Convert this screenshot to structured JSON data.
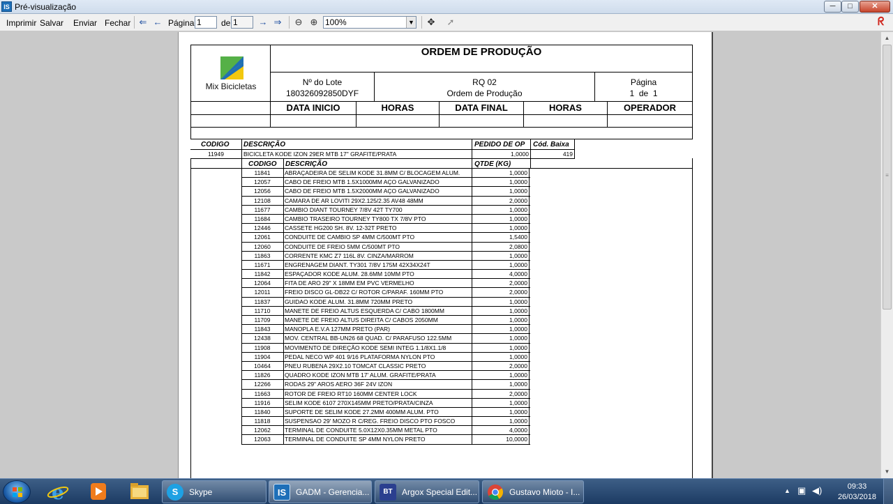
{
  "window": {
    "title": "Pré-visualização",
    "controls": {
      "minimize": "─",
      "maximize": "□",
      "close": "✕"
    }
  },
  "toolbar": {
    "print_label": "Imprimir",
    "save_label": "Salvar",
    "send_label": "Enviar",
    "close_label": "Fechar",
    "page_label": "Página",
    "page_value": "1",
    "of_label": "de",
    "total_pages": "1",
    "zoom_value": "100%"
  },
  "report": {
    "title": "ORDEM DE PRODUÇÃO",
    "logo_text": "Mix Bicicletas",
    "lot_label": "Nº do Lote",
    "lot_value": "180326092850DYF",
    "rq_code": "RQ 02",
    "rq_desc": "Ordem de Produção",
    "page_label": "Página",
    "page_value": "1  de  1",
    "columns": [
      "DATA INICIO",
      "HORAS",
      "DATA FINAL",
      "HORAS",
      "OPERADOR"
    ],
    "product_header": {
      "code": "CODIGO",
      "desc": "DESCRIÇÃO",
      "qty": "PEDIDO DE OP",
      "lower_code": "Cód. Baixa"
    },
    "product": {
      "code": "11949",
      "desc": "BICICLETA KODE IZON 29ER MTB 17\" GRAFITE/PRATA",
      "qty": "1,0000",
      "lower_code": "419"
    },
    "materials_header": {
      "code": "CODIGO",
      "desc": "DESCRIÇÃO",
      "qty": "QTDE (KG)"
    },
    "materials": [
      {
        "code": "11841",
        "desc": "ABRAÇADEIRA DE SELIM KODE 31.8MM C/ BLOCAGEM ALUM.",
        "qty": "1,0000"
      },
      {
        "code": "12057",
        "desc": "CABO DE FREIO MTB 1.5X1000MM AÇO GALVANIZADO",
        "qty": "1,0000"
      },
      {
        "code": "12056",
        "desc": "CABO DE FREIO MTB 1.5X2000MM AÇO GALVANIZADO",
        "qty": "1,0000"
      },
      {
        "code": "12108",
        "desc": "CAMARA DE AR LOVITI 29X2.125/2.35 AV48 48MM",
        "qty": "2,0000"
      },
      {
        "code": "11677",
        "desc": "CAMBIO DIANT TOURNEY  7/8V 42T TY700",
        "qty": "1,0000"
      },
      {
        "code": "11684",
        "desc": "CAMBIO TRASEIRO TOURNEY TY800 TX 7/8V PTO",
        "qty": "1,0000"
      },
      {
        "code": "12446",
        "desc": "CASSETE HG200 SH. 8V. 12-32T PRETO",
        "qty": "1,0000"
      },
      {
        "code": "12061",
        "desc": "CONDUITE DE CAMBIO SP 4MM C/500MT PTO",
        "qty": "1,5400"
      },
      {
        "code": "12060",
        "desc": "CONDUITE DE FREIO 5MM C/500MT PTO",
        "qty": "2,0800"
      },
      {
        "code": "11863",
        "desc": "CORRENTE KMC Z7 116L 8V. CINZA/MARROM",
        "qty": "1,0000"
      },
      {
        "code": "11671",
        "desc": "ENGRENAGEM DIANT.  TY301 7/8V 175M 42X34X24T",
        "qty": "1,0000"
      },
      {
        "code": "11842",
        "desc": "ESPAÇADOR KODE ALUM. 28.6MM 10MM PTO",
        "qty": "4,0000"
      },
      {
        "code": "12064",
        "desc": "FITA DE ARO 29\" X 18MM EM PVC VERMELHO",
        "qty": "2,0000"
      },
      {
        "code": "12011",
        "desc": "FREIO DISCO GL-DB22 C/ ROTOR C/PARAF. 160MM PTO",
        "qty": "2,0000"
      },
      {
        "code": "11837",
        "desc": "GUIDAO KODE ALUM. 31.8MM 720MM PRETO",
        "qty": "1,0000"
      },
      {
        "code": "11710",
        "desc": "MANETE DE  FREIO ALTUS ESQUERDA C/ CABO 1800MM",
        "qty": "1,0000"
      },
      {
        "code": "11709",
        "desc": "MANETE DE FREIO ALTUS DIREITA C/ CABOS 2050MM",
        "qty": "1,0000"
      },
      {
        "code": "11843",
        "desc": "MANOPLA E.V.A 127MM PRETO (PAR)",
        "qty": "1,0000"
      },
      {
        "code": "12438",
        "desc": "MOV. CENTRAL BB-UN26 68 QUAD. C/ PARAFUSO 122.5MM",
        "qty": "1,0000"
      },
      {
        "code": "11908",
        "desc": "MOVIMENTO DE DIREÇÃO KODE SEMI INTEG 1.1/8X1.1/8",
        "qty": "1,0000"
      },
      {
        "code": "11904",
        "desc": "PEDAL NECO WP 401 9/16 PLATAFORMA NYLON PTO",
        "qty": "1,0000"
      },
      {
        "code": "10464",
        "desc": "PNEU RUBENA 29X2.10 TOMCAT CLASSIC PRETO",
        "qty": "2,0000"
      },
      {
        "code": "11826",
        "desc": "QUADRO KODE IZON MTB 17' ALUM. GRAFITE/PRATA",
        "qty": "1,0000"
      },
      {
        "code": "12266",
        "desc": "RODAS 29\" AROS AERO 36F 24V IZON",
        "qty": "1,0000"
      },
      {
        "code": "11663",
        "desc": "ROTOR DE FREIO RT10 160MM CENTER LOCK",
        "qty": "2,0000"
      },
      {
        "code": "11916",
        "desc": "SELIM KODE 6107 270X145MM PRETO/PRATA/CINZA",
        "qty": "1,0000"
      },
      {
        "code": "11840",
        "desc": "SUPORTE DE SELIM KODE 27.2MM 400MM ALUM. PTO",
        "qty": "1,0000"
      },
      {
        "code": "11818",
        "desc": "SUSPENSAO 29' MOZO R C/REG. FREIO DISCO PTO FOSCO",
        "qty": "1,0000"
      },
      {
        "code": "12062",
        "desc": "TERMINAL DE CONDUITE 5.0X12X0.35MM METAL PTO",
        "qty": "4,0000"
      },
      {
        "code": "12063",
        "desc": "TERMINAL DE CONDUITE SP 4MM NYLON PRETO",
        "qty": "10,0000"
      }
    ]
  },
  "taskbar": {
    "buttons": [
      {
        "label": "Skype",
        "icon": "skype-icon"
      },
      {
        "label": "GADM - Gerencia...",
        "icon": "is-app-icon"
      },
      {
        "label": "Argox Special Edit...",
        "icon": "bt-app-icon"
      },
      {
        "label": "Gustavo Mioto - I...",
        "icon": "chrome-icon"
      }
    ],
    "time": "09:33",
    "date": "26/03/2018"
  },
  "colors": {
    "logo_blue": "#1f6fb5",
    "logo_green": "#55b047",
    "logo_yellow": "#f2c80f",
    "taskbar": "#1c3b63"
  }
}
